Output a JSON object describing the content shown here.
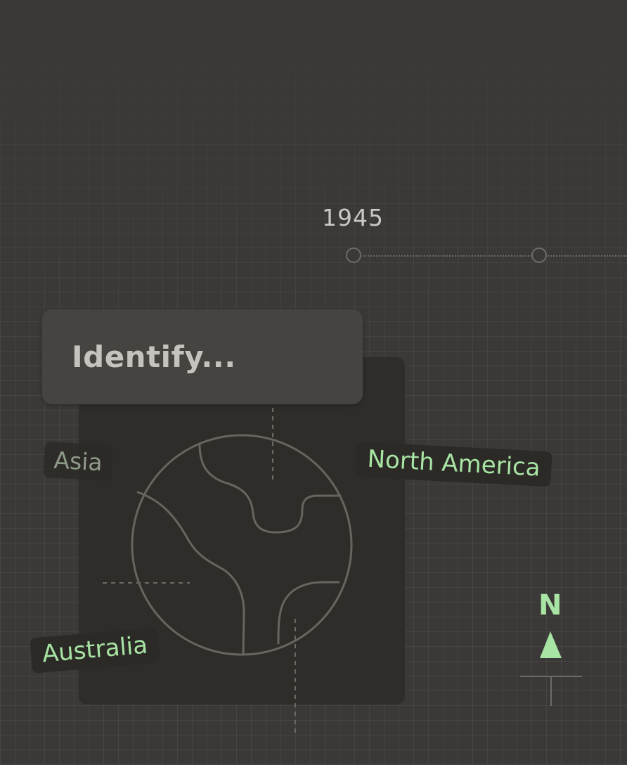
{
  "timeline": {
    "year": "1945"
  },
  "card": {
    "title": "Identify..."
  },
  "labels": {
    "asia": "Asia",
    "north_america": "North America",
    "australia": "Australia"
  },
  "compass": {
    "letter": "N"
  },
  "colors": {
    "background": "#3a3937",
    "card": "#2f2d29",
    "header": "#454441",
    "accent": "#a8e4a3",
    "muted_label": "#8e9a88",
    "line": "#6c6b66"
  },
  "icons": [
    "globe-icon",
    "compass-arrow-icon"
  ]
}
